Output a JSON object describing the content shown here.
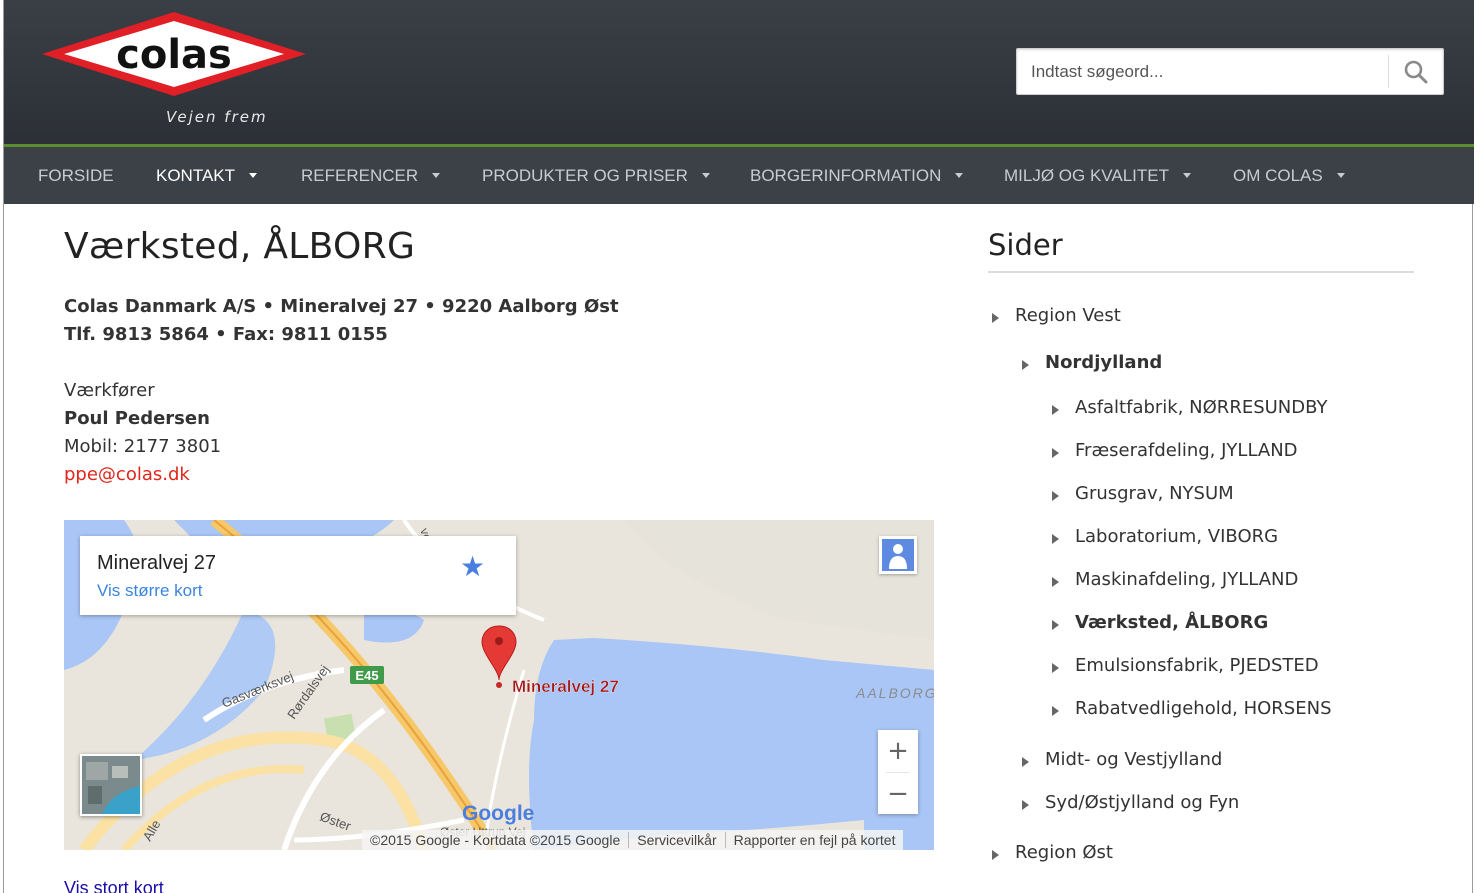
{
  "header": {
    "logo_text": "colas",
    "tagline": "Vejen frem",
    "search_placeholder": "Indtast søgeord..."
  },
  "nav": [
    {
      "label": "FORSIDE",
      "caret": false,
      "active": false
    },
    {
      "label": "KONTAKT",
      "caret": true,
      "active": true
    },
    {
      "label": "REFERENCER",
      "caret": true,
      "active": false
    },
    {
      "label": "PRODUKTER OG PRISER",
      "caret": true,
      "active": false
    },
    {
      "label": "BORGERINFORMATION",
      "caret": true,
      "active": false
    },
    {
      "label": "MILJØ OG KVALITET",
      "caret": true,
      "active": false
    },
    {
      "label": "OM COLAS",
      "caret": true,
      "active": false
    }
  ],
  "main": {
    "title": "Værksted, ÅLBORG",
    "address_line": "Colas Danmark A/S • Mineralvej 27 • 9220 Aalborg Øst",
    "phone_line": "Tlf. 9813 5864 • Fax: 9811 0155",
    "role": "Værkfører",
    "name": "Poul Pedersen",
    "mobile": "Mobil: 2177 3801",
    "email": "ppe@colas.dk",
    "bottom_link": "Vis stort kort"
  },
  "map": {
    "card_title": "Mineralvej 27",
    "card_link": "Vis større kort",
    "pin_label": "Mineralvej 27",
    "place_label": "AALBORG",
    "road_badge": "E45",
    "streets": [
      "Gasværksvej",
      "Rørdalsvej",
      "Øster",
      "Øster Uttrup Vej",
      "Alle",
      "vej"
    ],
    "google_logo": "Google",
    "zoom_in": "+",
    "zoom_out": "−",
    "attribution": [
      "©2015 Google - Kortdata ©2015 Google",
      "Servicevilkår",
      "Rapporter en fejl på kortet"
    ]
  },
  "sidebar": {
    "title": "Sider",
    "items": [
      {
        "label": "Region Vest",
        "level": 0,
        "bold": false
      },
      {
        "label": "Nordjylland",
        "level": 1,
        "bold": true
      },
      {
        "label": "Asfaltfabrik, NØRRESUNDBY",
        "level": 2,
        "bold": false
      },
      {
        "label": "Fræserafdeling, JYLLAND",
        "level": 2,
        "bold": false
      },
      {
        "label": "Grusgrav, NYSUM",
        "level": 2,
        "bold": false
      },
      {
        "label": "Laboratorium, VIBORG",
        "level": 2,
        "bold": false
      },
      {
        "label": "Maskinafdeling, JYLLAND",
        "level": 2,
        "bold": false
      },
      {
        "label": "Værksted, ÅLBORG",
        "level": 2,
        "bold": true
      },
      {
        "label": "Emulsionsfabrik, PJEDSTED",
        "level": 2,
        "bold": false
      },
      {
        "label": "Rabatvedligehold, HORSENS",
        "level": 2,
        "bold": false
      },
      {
        "label": "Midt- og Vestjylland",
        "level": 1,
        "bold": false
      },
      {
        "label": "Syd/Østjylland og Fyn",
        "level": 1,
        "bold": false
      },
      {
        "label": "Region Øst",
        "level": 0,
        "bold": false
      }
    ]
  },
  "colors": {
    "header_bg": "#2f343a",
    "nav_bg": "#3c4148",
    "nav_accent": "#5a8f2e",
    "email": "#e0261c",
    "logo_red": "#e01f26",
    "map_water": "#a9c6f6",
    "map_link": "#3a84df",
    "pin": "#e53935"
  }
}
